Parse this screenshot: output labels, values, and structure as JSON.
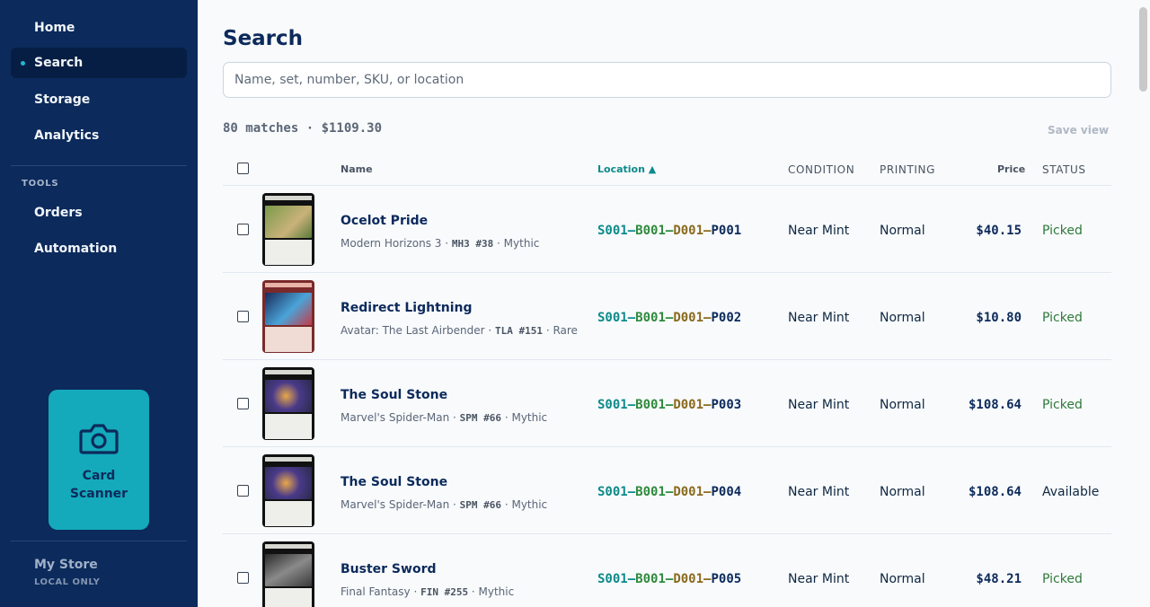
{
  "nav": {
    "items": [
      {
        "label": "Home"
      },
      {
        "label": "Search"
      },
      {
        "label": "Storage"
      },
      {
        "label": "Analytics"
      }
    ],
    "section_label": "TOOLS",
    "tool_items": [
      {
        "label": "Orders"
      },
      {
        "label": "Automation"
      }
    ],
    "scanner_label_1": "Card",
    "scanner_label_2": "Scanner",
    "store_name": "My Store",
    "store_mode": "LOCAL ONLY"
  },
  "page": {
    "title": "Search",
    "search_placeholder": "Name, set, number, SKU, or location",
    "summary": "80 matches · $1109.30",
    "save_view": "Save view"
  },
  "table": {
    "headers": {
      "name": "Name",
      "location": "Location ▲",
      "condition": "CONDITION",
      "printing": "PRINTING",
      "price": "Price",
      "status": "STATUS"
    },
    "rows": [
      {
        "name": "Ocelot Pride",
        "set": "Modern Horizons 3 · ",
        "code": "MH3 #38",
        "rarity": " · Mythic",
        "loc": {
          "s": "S001",
          "b": "B001",
          "d": "D001",
          "p": "P001"
        },
        "dash": "–",
        "condition": "Near Mint",
        "printing": "Normal",
        "price": "$40.15",
        "status": "Picked"
      },
      {
        "name": "Redirect Lightning",
        "set": "Avatar: The Last Airbender · ",
        "code": "TLA #151",
        "rarity": " · Rare",
        "loc": {
          "s": "S001",
          "b": "B001",
          "d": "D001",
          "p": "P002"
        },
        "dash": "–",
        "condition": "Near Mint",
        "printing": "Normal",
        "price": "$10.80",
        "status": "Picked"
      },
      {
        "name": "The Soul Stone",
        "set": "Marvel's Spider-Man · ",
        "code": "SPM #66",
        "rarity": " · Mythic",
        "loc": {
          "s": "S001",
          "b": "B001",
          "d": "D001",
          "p": "P003"
        },
        "dash": "–",
        "condition": "Near Mint",
        "printing": "Normal",
        "price": "$108.64",
        "status": "Picked"
      },
      {
        "name": "The Soul Stone",
        "set": "Marvel's Spider-Man · ",
        "code": "SPM #66",
        "rarity": " · Mythic",
        "loc": {
          "s": "S001",
          "b": "B001",
          "d": "D001",
          "p": "P004"
        },
        "dash": "–",
        "condition": "Near Mint",
        "printing": "Normal",
        "price": "$108.64",
        "status": "Available"
      },
      {
        "name": "Buster Sword",
        "set": "Final Fantasy · ",
        "code": "FIN #255",
        "rarity": " · Mythic",
        "loc": {
          "s": "S001",
          "b": "B001",
          "d": "D001",
          "p": "P005"
        },
        "dash": "–",
        "condition": "Near Mint",
        "printing": "Normal",
        "price": "$48.21",
        "status": "Picked"
      }
    ]
  },
  "colors": {
    "sidebar": "#0c2a5b",
    "accent": "#14aabb",
    "loc_s": "#0e8a8a",
    "loc_b": "#2f8a3c",
    "loc_d": "#8a6a1e",
    "loc_p": "#0c2a5b",
    "status_picked": "#2f7a3a",
    "status_available": "#0f2740"
  },
  "icons": {
    "scanner": "camera-icon"
  }
}
